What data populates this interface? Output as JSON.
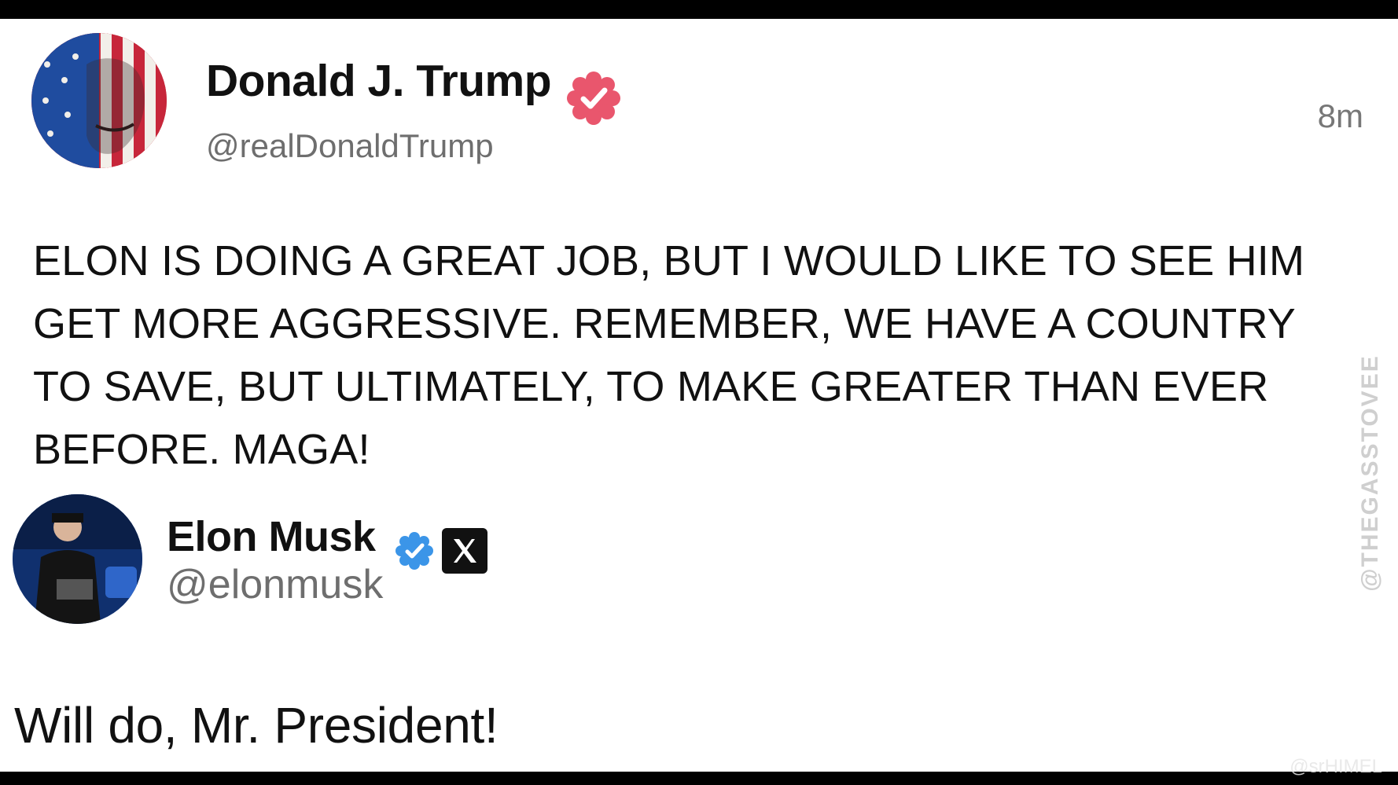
{
  "post": {
    "author": {
      "name": "Donald J. Trump",
      "handle": "@realDonaldTrump"
    },
    "timestamp": "8m",
    "text": "ELON IS DOING A GREAT JOB, BUT I WOULD LIKE TO SEE HIM GET MORE AGGRESSIVE. REMEMBER, WE HAVE A COUNTRY TO SAVE, BUT ULTIMATELY, TO MAKE GREATER THAN EVER BEFORE. MAGA!"
  },
  "reply": {
    "author": {
      "name": "Elon Musk",
      "handle": "@elonmusk"
    },
    "text": "Will do, Mr. President!"
  },
  "watermarks": {
    "side": "@THEGASSTOVEE",
    "corner": "@srHIMEL"
  },
  "icons": [
    "verified-badge-icon",
    "x-logo-icon"
  ],
  "colors": {
    "trump_badge": "#e9566d",
    "musk_badge": "#3b95e8",
    "background": "#ffffff"
  }
}
